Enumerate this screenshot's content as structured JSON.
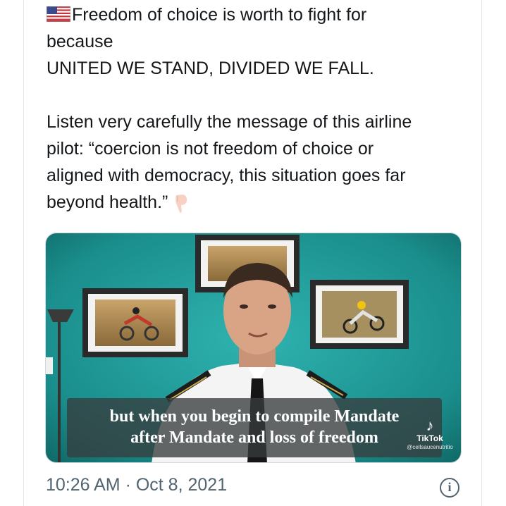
{
  "tweet": {
    "line1": "Freedom of choice is worth to fight for",
    "line2": "because",
    "line3": "UNITED WE STAND, DIVIDED WE FALL.",
    "para2": [
      "Listen very carefully the message of this airline",
      "pilot: “coercion is not freedom of choice or",
      "aligned with democracy, this situation goes far",
      "beyond health.”"
    ],
    "flag_icon": "us-flag-emoji",
    "pointing_icon": "backhand-index-pointing-down-emoji"
  },
  "video": {
    "subtitle_line1": "but when you begin to compile Mandate",
    "subtitle_line2": "after Mandate and loss of freedom",
    "watermark_brand": "TikTok",
    "watermark_handle": "@cellsaucenutritio",
    "watermark_icon": "tiktok-note-icon"
  },
  "meta": {
    "timestamp": "10:26 AM · Oct 8, 2021",
    "info_icon": "info-circle-icon"
  },
  "colors": {
    "text": "#14171a",
    "muted": "#536471",
    "border": "#e1e8ed",
    "video_wall": "#1f8f8d"
  }
}
